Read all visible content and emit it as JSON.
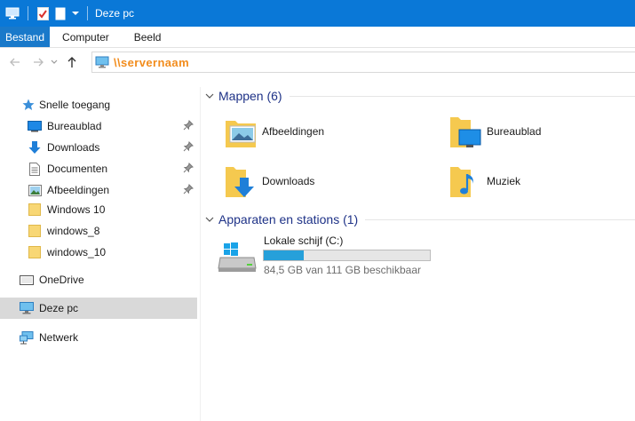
{
  "window": {
    "title": "Deze pc"
  },
  "ribbon": {
    "tabs": [
      {
        "label": "Bestand",
        "active": true
      },
      {
        "label": "Computer",
        "active": false
      },
      {
        "label": "Beeld",
        "active": false
      }
    ]
  },
  "address": {
    "path": "\\\\servernaam"
  },
  "sidebar": {
    "quick_access_label": "Snelle toegang",
    "quick_items": [
      {
        "label": "Bureaublad",
        "icon": "desktop-icon",
        "pinned": true
      },
      {
        "label": "Downloads",
        "icon": "download-icon",
        "pinned": true
      },
      {
        "label": "Documenten",
        "icon": "document-icon",
        "pinned": true
      },
      {
        "label": "Afbeeldingen",
        "icon": "pictures-icon",
        "pinned": true
      },
      {
        "label": "Windows 10",
        "icon": "folder-icon",
        "pinned": false
      },
      {
        "label": "windows_8",
        "icon": "folder-icon",
        "pinned": false
      },
      {
        "label": "windows_10",
        "icon": "folder-icon",
        "pinned": false
      }
    ],
    "onedrive_label": "OneDrive",
    "thispc_label": "Deze pc",
    "network_label": "Netwerk"
  },
  "main": {
    "folders_header": "Mappen (6)",
    "folders": [
      {
        "label": "Afbeeldingen",
        "icon": "pictures-folder-icon"
      },
      {
        "label": "Bureaublad",
        "icon": "desktop-folder-icon"
      },
      {
        "label": "Downloads",
        "icon": "downloads-folder-icon"
      },
      {
        "label": "Muziek",
        "icon": "music-folder-icon"
      }
    ],
    "devices_header": "Apparaten en stations (1)",
    "drive": {
      "name": "Lokale schijf (C:)",
      "free_text": "84,5 GB van 111 GB beschikbaar",
      "used_fraction": 0.24
    }
  },
  "colors": {
    "titlebar": "#0a78d7",
    "accent": "#1979ca",
    "address_path": "#f28c1c",
    "group_header": "#1e3287",
    "drive_bar": "#26a0da"
  }
}
